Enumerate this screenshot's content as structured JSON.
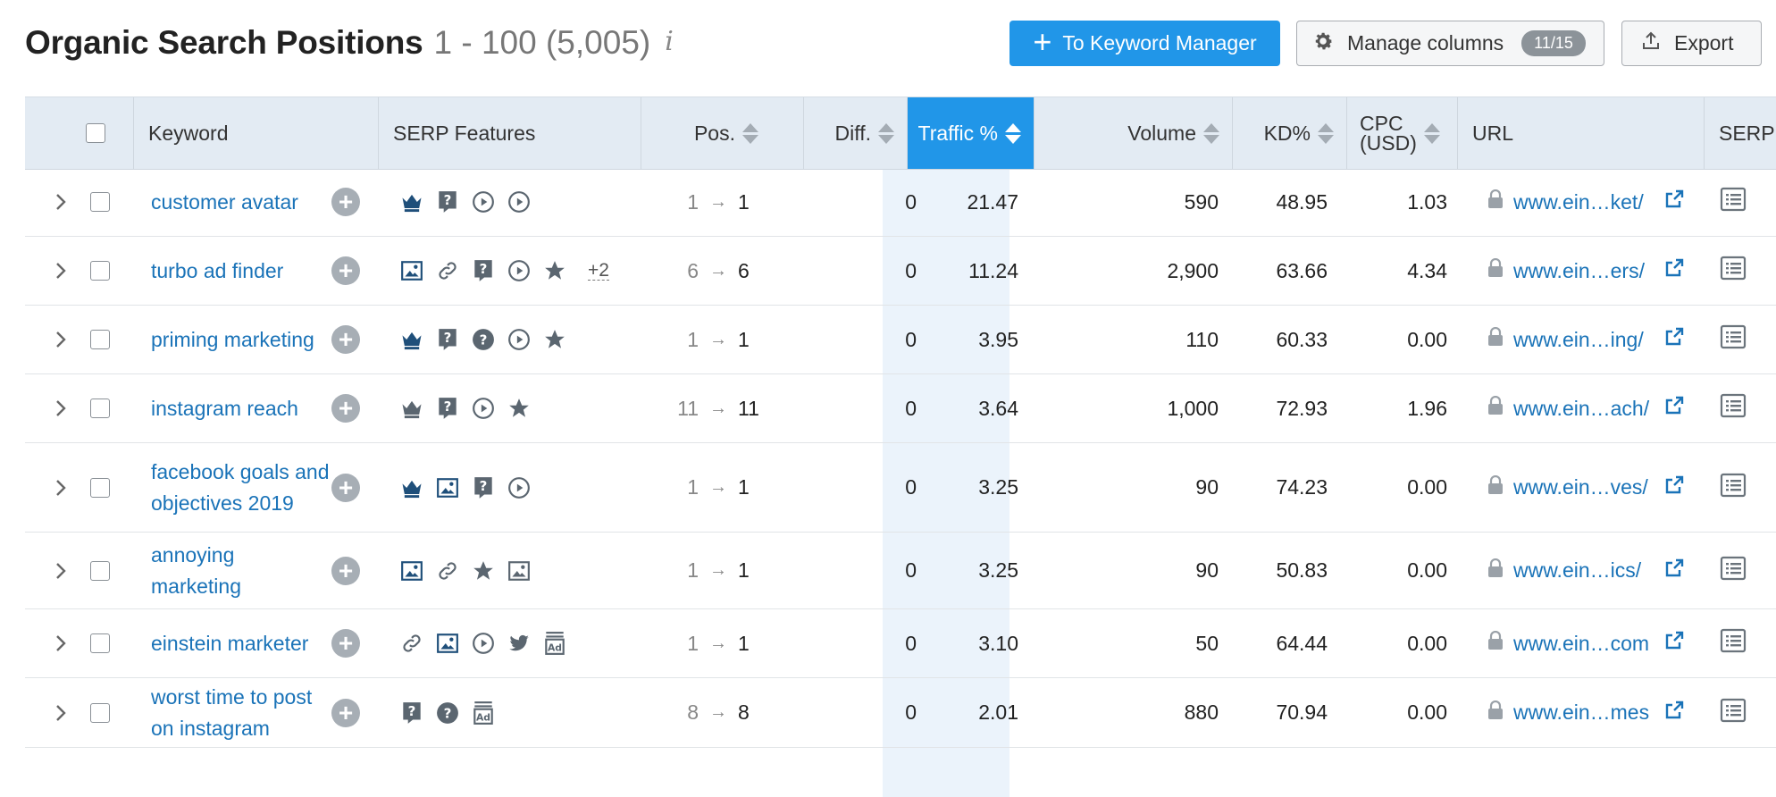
{
  "header": {
    "title": "Organic Search Positions",
    "range": "1 - 100 (5,005)",
    "info_glyph": "i"
  },
  "buttons": {
    "keyword_manager": "To Keyword Manager",
    "manage_columns": "Manage columns",
    "manage_columns_badge": "11/15",
    "export": "Export"
  },
  "columns": {
    "keyword": "Keyword",
    "serp_features": "SERP Features",
    "pos": "Pos.",
    "diff": "Diff.",
    "traffic": "Traffic %",
    "volume": "Volume",
    "kd": "KD%",
    "cpc_line1": "CPC",
    "cpc_line2": "(USD)",
    "url": "URL",
    "serp": "SERP"
  },
  "colors": {
    "accent": "#2196e8",
    "link": "#1a73b8",
    "header_bg": "#e3ebf3"
  },
  "rows": [
    {
      "keyword": "customer avatar",
      "features": [
        "crown",
        "question-box",
        "play-circle",
        "play-circle"
      ],
      "more": "",
      "prev": "1",
      "pos": "1",
      "diff": "0",
      "traffic": "21.47",
      "volume": "590",
      "kd": "48.95",
      "cpc": "1.03",
      "url": "www.ein…ket/"
    },
    {
      "keyword": "turbo ad finder",
      "features": [
        "image",
        "link",
        "question-box",
        "play-circle",
        "star"
      ],
      "more": "+2",
      "prev": "6",
      "pos": "6",
      "diff": "0",
      "traffic": "11.24",
      "volume": "2,900",
      "kd": "63.66",
      "cpc": "4.34",
      "url": "www.ein…ers/"
    },
    {
      "keyword": "priming marketing",
      "features": [
        "crown",
        "question-box",
        "question-circle",
        "play-circle",
        "star"
      ],
      "more": "",
      "prev": "1",
      "pos": "1",
      "diff": "0",
      "traffic": "3.95",
      "volume": "110",
      "kd": "60.33",
      "cpc": "0.00",
      "url": "www.ein…ing/"
    },
    {
      "keyword": "instagram reach",
      "features": [
        "crown-outline",
        "question-box",
        "play-circle",
        "star"
      ],
      "more": "",
      "prev": "11",
      "pos": "11",
      "diff": "0",
      "traffic": "3.64",
      "volume": "1,000",
      "kd": "72.93",
      "cpc": "1.96",
      "url": "www.ein…ach/"
    },
    {
      "keyword": "facebook goals and objectives 2019",
      "features": [
        "crown",
        "image",
        "question-box",
        "play-circle"
      ],
      "more": "",
      "prev": "1",
      "pos": "1",
      "diff": "0",
      "traffic": "3.25",
      "volume": "90",
      "kd": "74.23",
      "cpc": "0.00",
      "url": "www.ein…ves/"
    },
    {
      "keyword": "annoying marketing",
      "features": [
        "image",
        "link",
        "star",
        "image-outline"
      ],
      "more": "",
      "prev": "1",
      "pos": "1",
      "diff": "0",
      "traffic": "3.25",
      "volume": "90",
      "kd": "50.83",
      "cpc": "0.00",
      "url": "www.ein…ics/"
    },
    {
      "keyword": "einstein marketer",
      "features": [
        "link",
        "image",
        "play-circle",
        "twitter",
        "ad"
      ],
      "more": "",
      "prev": "1",
      "pos": "1",
      "diff": "0",
      "traffic": "3.10",
      "volume": "50",
      "kd": "64.44",
      "cpc": "0.00",
      "url": "www.ein…com"
    },
    {
      "keyword": "worst time to post on instagram",
      "features": [
        "question-box",
        "question-circle",
        "ad"
      ],
      "more": "",
      "prev": "8",
      "pos": "8",
      "diff": "0",
      "traffic": "2.01",
      "volume": "880",
      "kd": "70.94",
      "cpc": "0.00",
      "url": "www.ein…mes"
    }
  ]
}
